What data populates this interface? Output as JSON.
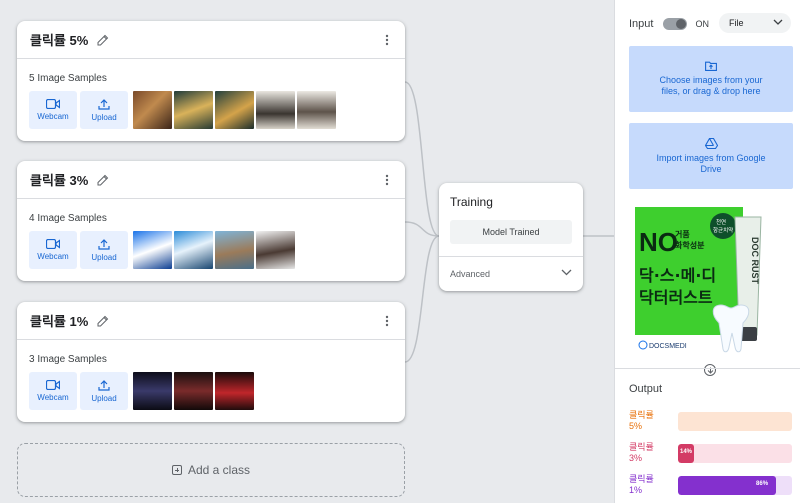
{
  "classes": [
    {
      "title": "클릭률 5%",
      "samples_label": "5 Image Samples",
      "webcam_label": "Webcam",
      "upload_label": "Upload"
    },
    {
      "title": "클릭률 3%",
      "samples_label": "4 Image Samples",
      "webcam_label": "Webcam",
      "upload_label": "Upload"
    },
    {
      "title": "클릭률 1%",
      "samples_label": "3 Image Samples",
      "webcam_label": "Webcam",
      "upload_label": "Upload"
    }
  ],
  "add_class_label": "Add a class",
  "training": {
    "title": "Training",
    "button_label": "Model Trained",
    "advanced_label": "Advanced"
  },
  "input_panel": {
    "input_label": "Input",
    "toggle_state": "ON",
    "source_select": "File",
    "choose_images": "Choose images from your files, or drag & drop here",
    "import_drive": "Import images from Google Drive"
  },
  "preview_image_text": {
    "headline_big": "NO",
    "headline_small": "거품\n화학성분",
    "line1": "닥·스·메·디",
    "line2": "닥터러스트",
    "badge": "천연\n항균치약",
    "brand": "DOCSMEDI",
    "tube_label": "DOC RUST"
  },
  "output": {
    "title": "Output",
    "items": [
      {
        "label": "클릭률\n5%",
        "percent": 0,
        "percent_label": "",
        "color": "#e8710a",
        "track": "#fde4d3"
      },
      {
        "label": "클릭률\n3%",
        "percent": 14,
        "percent_label": "14%",
        "color": "#d33b65",
        "track": "#fbe0e7"
      },
      {
        "label": "클릭률\n1%",
        "percent": 86,
        "percent_label": "86%",
        "color": "#8430ce",
        "track": "#eedff9"
      }
    ]
  },
  "colors": {
    "accent_blue": "#1967d2",
    "drop_zone": "#c6dafc",
    "button_bg": "#e8f0fe"
  }
}
